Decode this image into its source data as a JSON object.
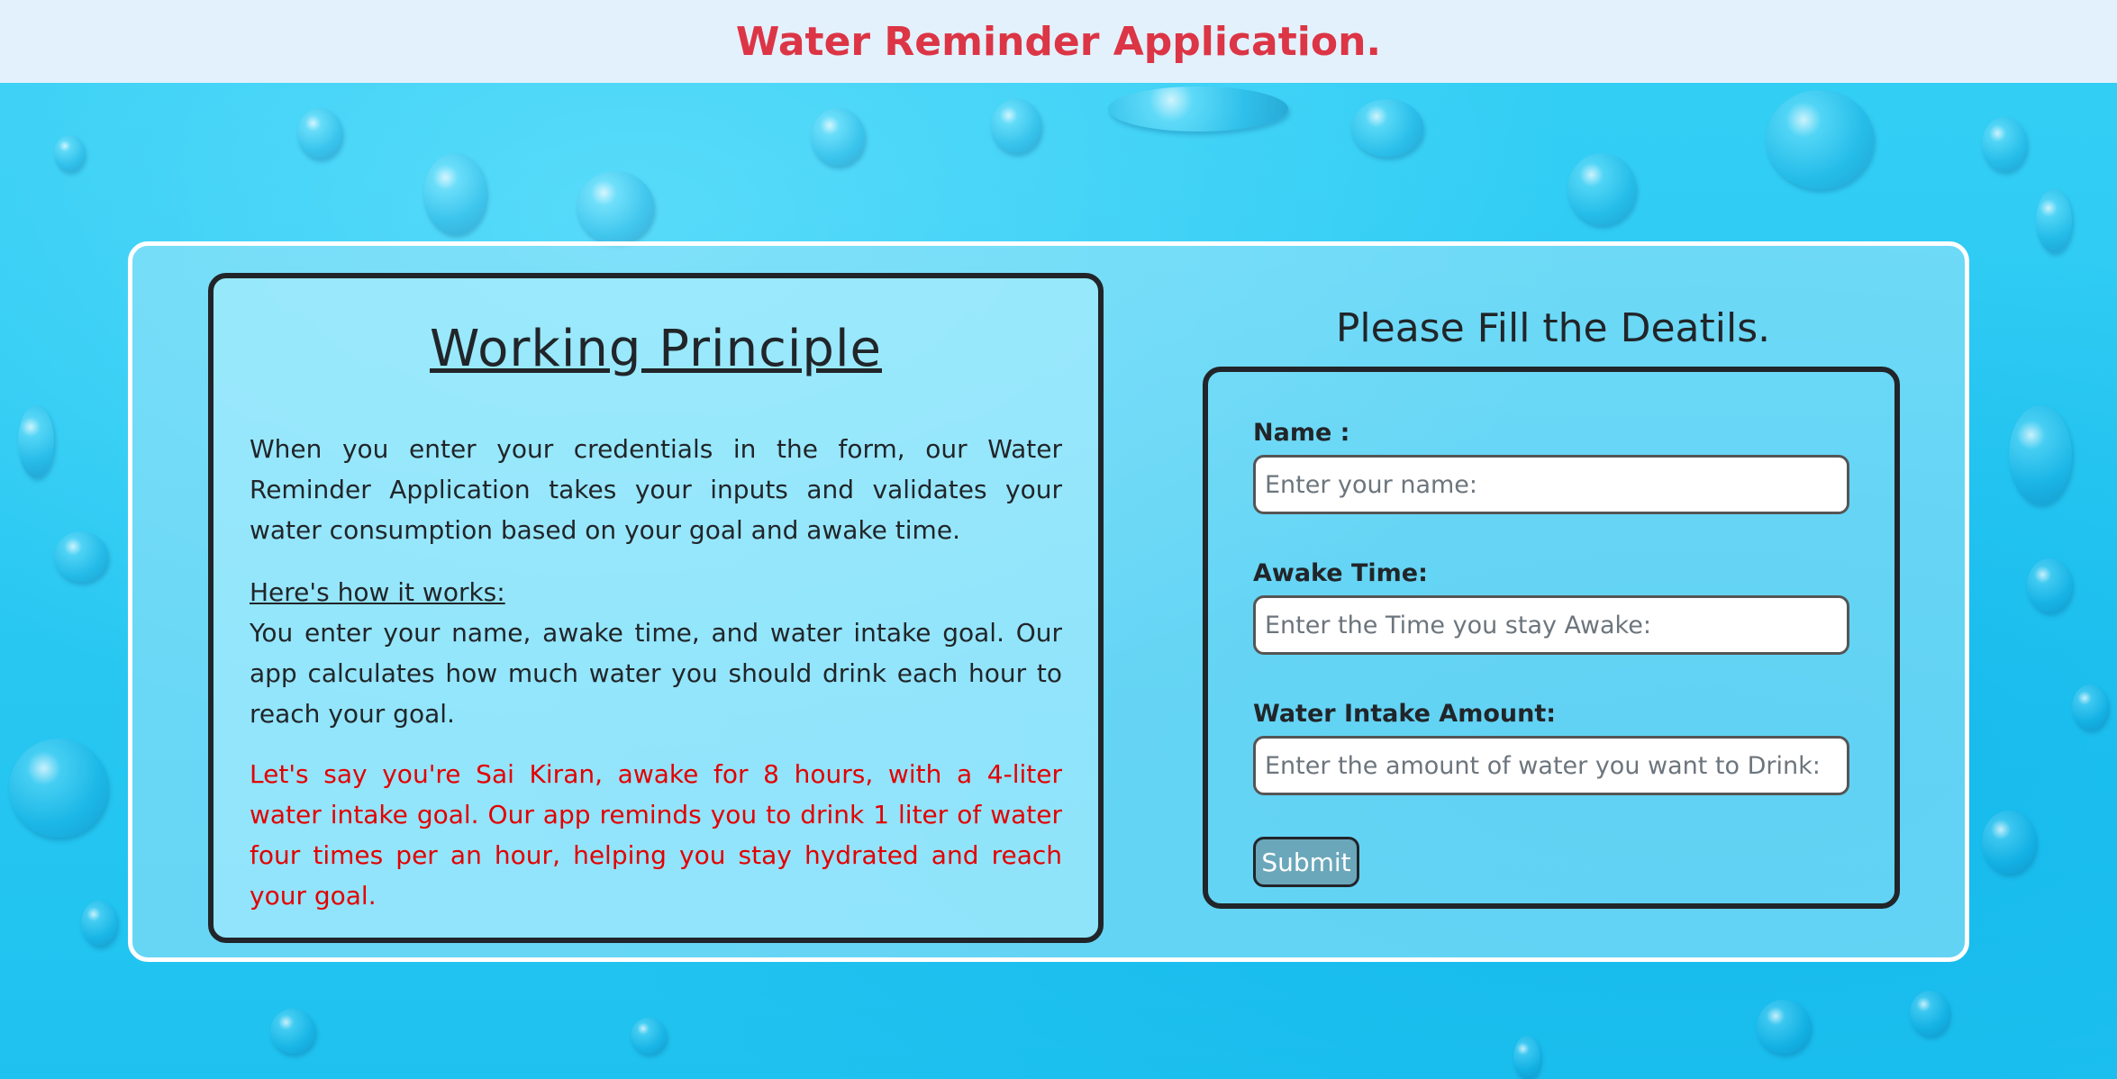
{
  "header": {
    "title": "Water Reminder Application."
  },
  "principle": {
    "title": "Working Principle",
    "intro": "When you enter your credentials in the form, our Water Reminder Application takes your inputs and validates your water consumption based on your goal and awake time.",
    "how_title": "Here's how it works:",
    "how_text": "You enter your name, awake time, and water intake goal. Our app calculates how much water you should drink each hour to reach your goal.",
    "example": "Let's say you're Sai Kiran, awake for 8 hours, with a 4-liter water intake goal. Our app reminds you to drink 1 liter of water four times per an hour, helping you stay hydrated and reach your goal."
  },
  "form": {
    "title": "Please Fill the Deatils.",
    "name_label": "Name :",
    "name_placeholder": "Enter your name:",
    "awake_label": "Awake Time:",
    "awake_placeholder": "Enter the Time you stay Awake:",
    "water_label": "Water Intake Amount:",
    "water_placeholder": "Enter the amount of water you want to Drink:",
    "submit_label": "Submit"
  },
  "colors": {
    "header_title": "#dc3545",
    "header_bg": "#e3f1fc",
    "example_text": "#e30000",
    "submit_bg": "#6ba7bb"
  }
}
